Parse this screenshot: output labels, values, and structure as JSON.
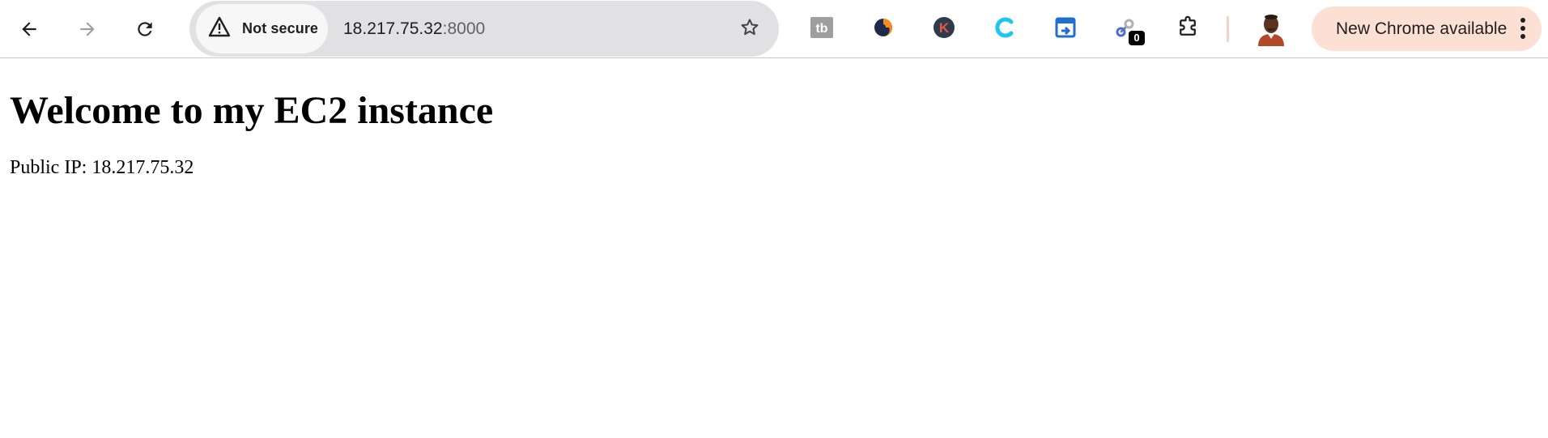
{
  "toolbar": {
    "back_icon": "arrow-left-icon",
    "forward_icon": "arrow-right-icon",
    "reload_icon": "reload-icon",
    "security_chip": {
      "icon": "warning-triangle-icon",
      "label": "Not secure"
    },
    "address": {
      "host": "18.217.75.32",
      "port": ":8000"
    },
    "bookmark_icon": "star-outline-icon",
    "extensions": [
      {
        "name": "tubebuddy-icon",
        "color": "#9e9e9e"
      },
      {
        "name": "orange-dark-logo-icon",
        "color": "#f58a1f"
      },
      {
        "name": "k-circle-icon",
        "color": "#2f3a4a"
      },
      {
        "name": "cyan-c-icon",
        "color": "#19c7f0"
      },
      {
        "name": "blue-share-window-icon",
        "color": "#1e6fcf"
      },
      {
        "name": "link-counter-icon",
        "color": "#4a6ec9",
        "badge": "0"
      }
    ],
    "extensions_menu_icon": "puzzle-piece-icon",
    "profile_avatar": "profile-avatar",
    "update_button": {
      "label": "New Chrome available",
      "icon": "three-dots-vertical-icon",
      "color": "#fce0d4"
    }
  },
  "content": {
    "heading": "Welcome to my EC2 instance",
    "ip_line": "Public IP: 18.217.75.32"
  }
}
